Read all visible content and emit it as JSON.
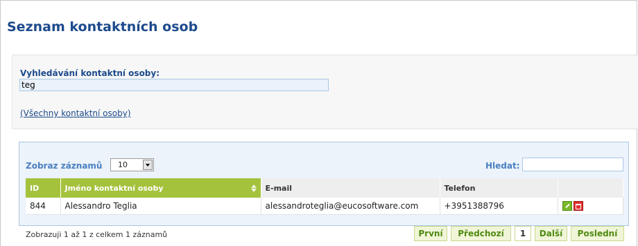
{
  "page": {
    "title": "Seznam kontaktních osob"
  },
  "search": {
    "label": "Vyhledávání kontaktní osoby:",
    "value": "teg",
    "all_contacts_link": "(Všechny kontaktní osoby)"
  },
  "table_controls": {
    "length_label": "Zobraz záznamů",
    "length_value": "10",
    "filter_label": "Hledat:",
    "filter_value": ""
  },
  "table": {
    "columns": [
      "ID",
      "Jméno kontaktní osoby",
      "E-mail",
      "Telefon",
      ""
    ],
    "sorted_column": "Jméno kontaktní osoby",
    "rows": [
      {
        "id": "844",
        "name": "Alessandro Teglia",
        "email": "alessandroteglia@eucosoftware.com",
        "phone": "+3951388796",
        "actions": [
          "edit-icon",
          "delete-icon"
        ]
      }
    ]
  },
  "footer": {
    "info": "Zobrazuji 1 až 1 z celkem 1 záznamů",
    "pagination": {
      "first": "První",
      "previous": "Předchozí",
      "current_page": "1",
      "next": "Další",
      "last": "Poslední"
    }
  },
  "colors": {
    "title": "#1c4a8c",
    "sorted_header": "#a4c23c",
    "edit_icon": "#7bb82a",
    "delete_icon": "#e03030",
    "pagination_text": "#4f8a12"
  }
}
